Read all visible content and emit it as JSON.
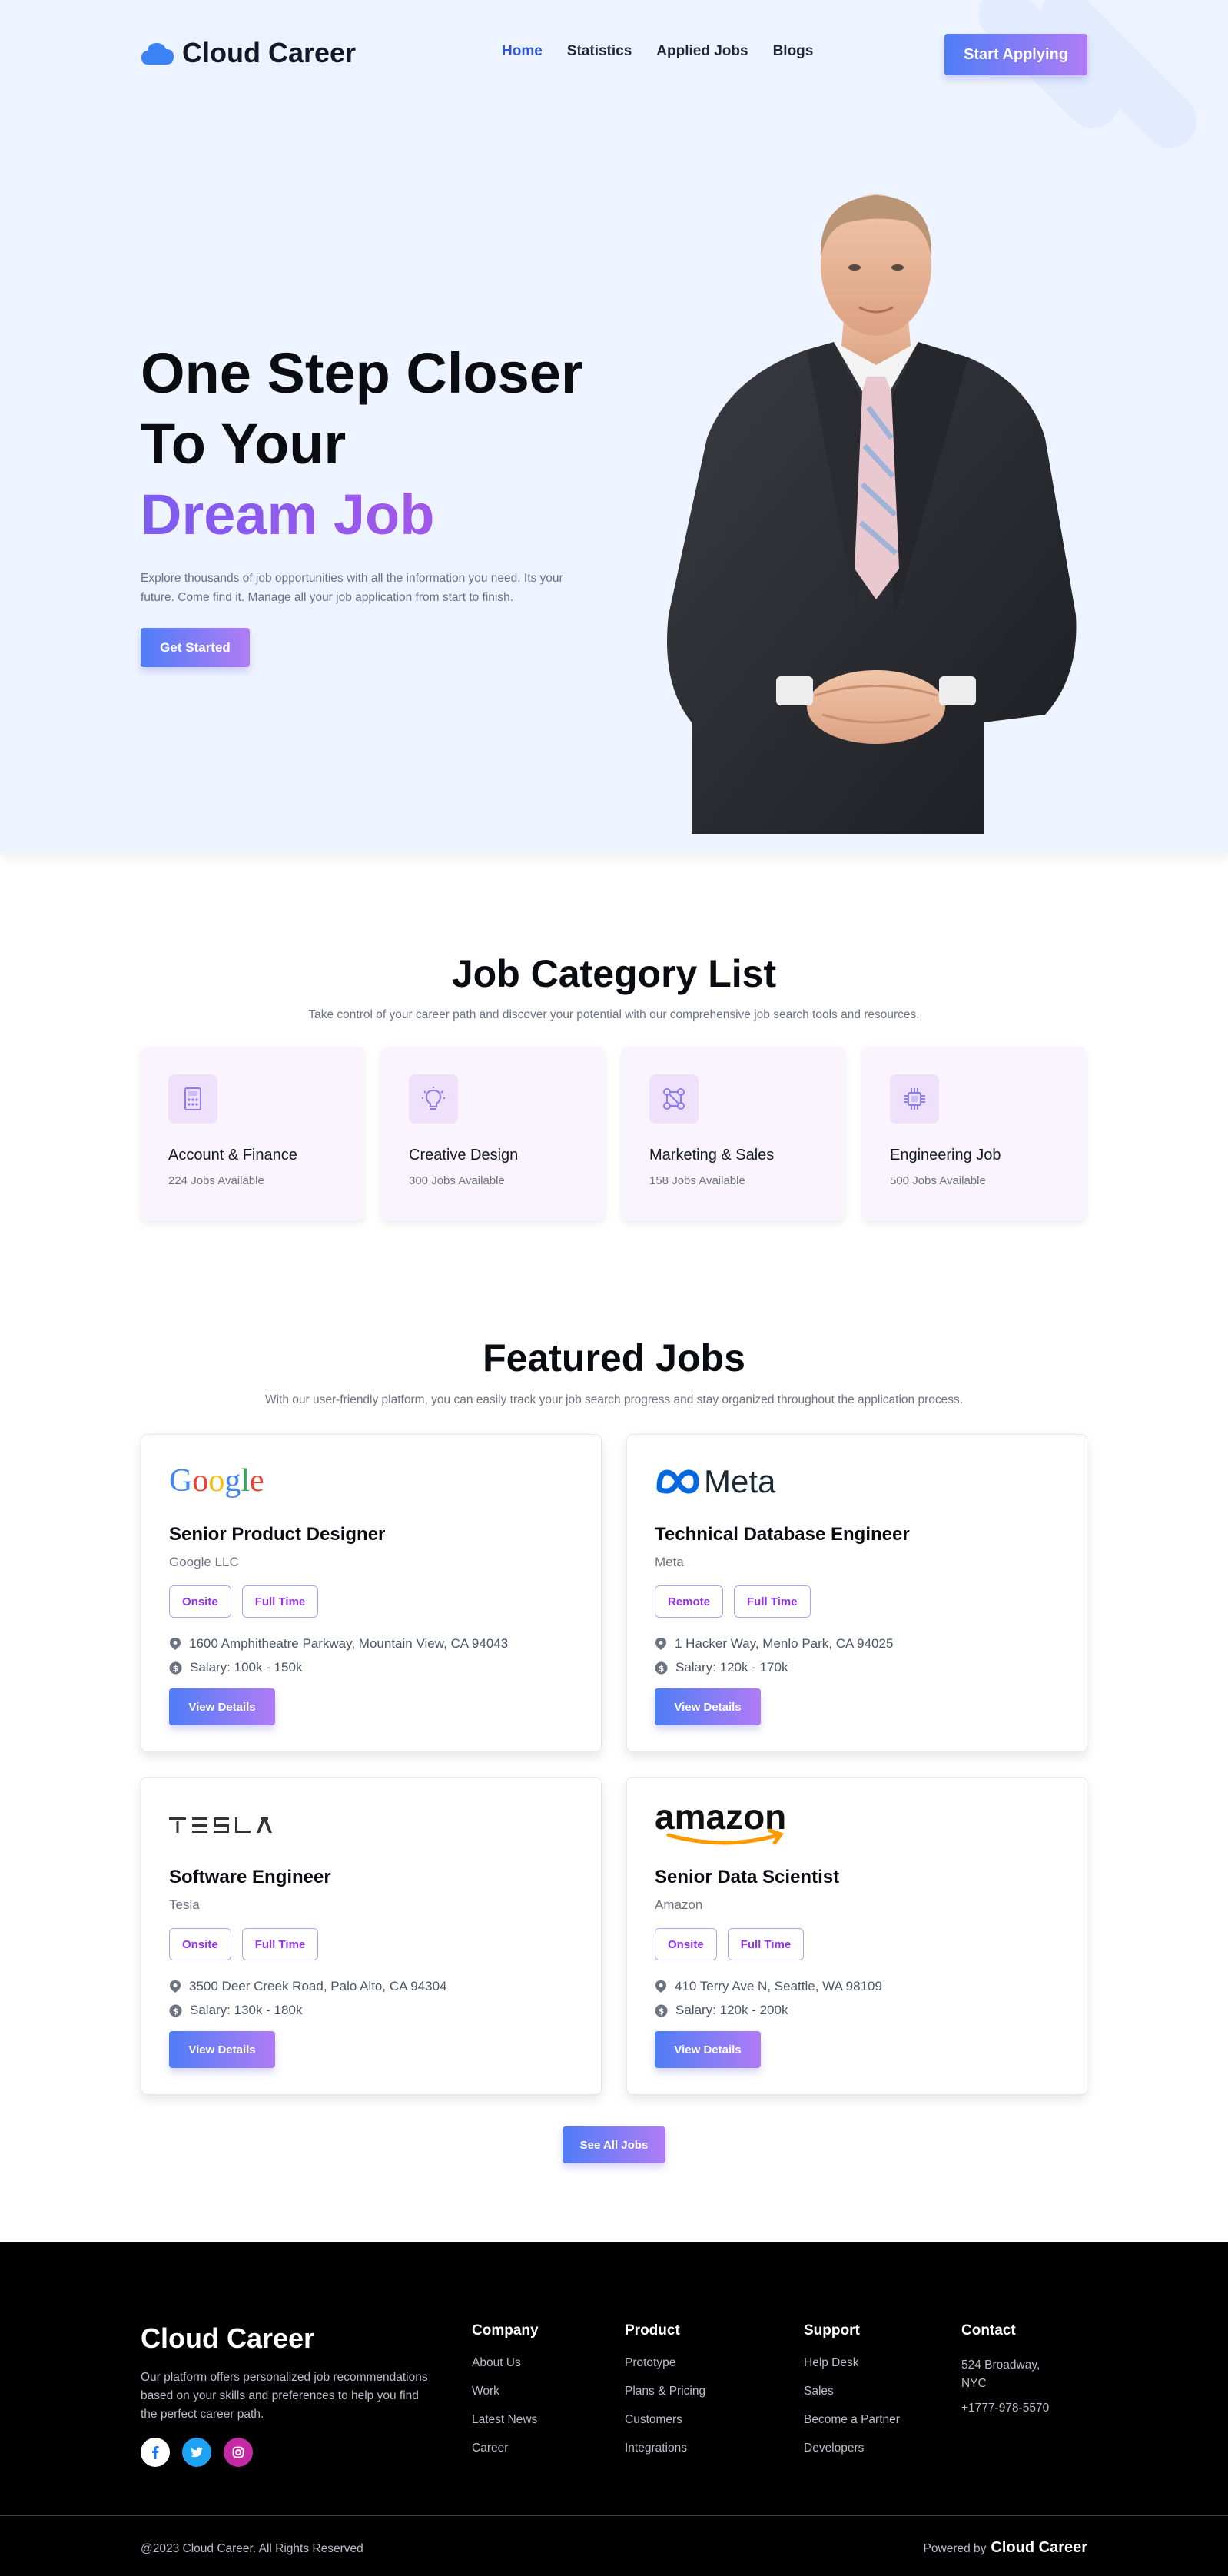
{
  "brand": "Cloud Career",
  "nav": {
    "items": [
      {
        "label": "Home",
        "active": true
      },
      {
        "label": "Statistics",
        "active": false
      },
      {
        "label": "Applied Jobs",
        "active": false
      },
      {
        "label": "Blogs",
        "active": false
      }
    ],
    "cta": "Start Applying"
  },
  "hero": {
    "line1": "One Step Closer",
    "line2": "To Your",
    "accent": "Dream Job",
    "description": "Explore thousands of job opportunities with all the information you need. Its your future. Come find it. Manage all your job application from start to finish.",
    "button": "Get Started"
  },
  "categories": {
    "title": "Job Category List",
    "subtitle": "Take control of your career path and discover your potential with our comprehensive job search tools and resources.",
    "items": [
      {
        "name": "Account & Finance",
        "count": "224 Jobs Available",
        "icon": "finance-icon"
      },
      {
        "name": "Creative Design",
        "count": "300 Jobs Available",
        "icon": "lightbulb-icon"
      },
      {
        "name": "Marketing & Sales",
        "count": "158 Jobs Available",
        "icon": "network-icon"
      },
      {
        "name": "Engineering Job",
        "count": "500 Jobs Available",
        "icon": "chip-icon"
      }
    ]
  },
  "featured": {
    "title": "Featured Jobs",
    "subtitle": "With our user-friendly platform, you can easily track your job search progress and stay organized throughout the application process.",
    "jobs": [
      {
        "logo": "Google",
        "title": "Senior Product Designer",
        "company": "Google LLC",
        "tags": [
          "Onsite",
          "Full Time"
        ],
        "address": "1600 Amphitheatre Parkway, Mountain View, CA 94043",
        "salary": "Salary: 100k - 150k",
        "button": "View Details"
      },
      {
        "logo": "Meta",
        "title": "Technical Database Engineer",
        "company": "Meta",
        "tags": [
          "Remote",
          "Full Time"
        ],
        "address": "1 Hacker Way, Menlo Park, CA 94025",
        "salary": "Salary: 120k - 170k",
        "button": "View Details"
      },
      {
        "logo": "TESLA",
        "title": "Software Engineer",
        "company": "Tesla",
        "tags": [
          "Onsite",
          "Full Time"
        ],
        "address": "3500 Deer Creek Road, Palo Alto, CA 94304",
        "salary": "Salary: 130k - 180k",
        "button": "View Details"
      },
      {
        "logo": "amazon",
        "title": "Senior Data Scientist",
        "company": "Amazon",
        "tags": [
          "Onsite",
          "Full Time"
        ],
        "address": "410 Terry Ave N, Seattle, WA 98109",
        "salary": "Salary: 120k - 200k",
        "button": "View Details"
      }
    ],
    "see_all": "See All Jobs"
  },
  "footer": {
    "brand": "Cloud Career",
    "description": "Our platform offers personalized job recommendations based on your skills and preferences to help you find the perfect career path.",
    "columns": [
      {
        "title": "Company",
        "links": [
          "About Us",
          "Work",
          "Latest News",
          "Career"
        ]
      },
      {
        "title": "Product",
        "links": [
          "Prototype",
          "Plans & Pricing",
          "Customers",
          "Integrations"
        ]
      },
      {
        "title": "Support",
        "links": [
          "Help Desk",
          "Sales",
          "Become a Partner",
          "Developers"
        ]
      }
    ],
    "contact": {
      "title": "Contact",
      "address": "524 Broadway, NYC",
      "phone": "+1777-978-5570"
    },
    "copyright": "@2023 Cloud Career. All Rights Reserved",
    "powered_label": "Powered by",
    "powered_brand": "Cloud Career"
  },
  "colors": {
    "accent": "#2f56d9",
    "gradient_start": "#4f7df6",
    "gradient_end": "#b07cf5",
    "hero_bg": "#eef4ff",
    "tag_text": "#9333ea"
  }
}
